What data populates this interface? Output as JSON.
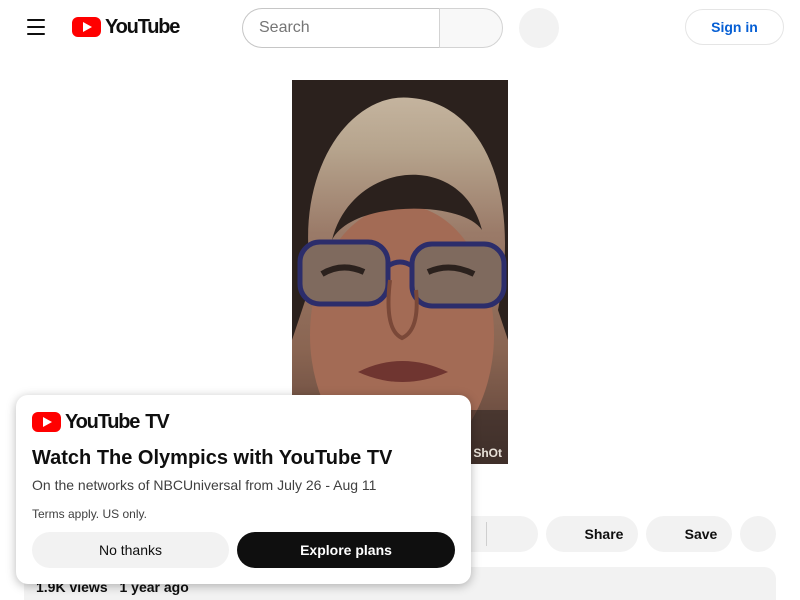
{
  "header": {
    "logo_text": "YouTube",
    "search_placeholder": "Search",
    "signin_label": "Sign in"
  },
  "video": {
    "watermark": "ShOt"
  },
  "actions": {
    "share_label": "Share",
    "save_label": "Save"
  },
  "description": {
    "views": "1.9K views",
    "age": "1 year ago"
  },
  "promo": {
    "logo_text": "YouTube",
    "logo_suffix": "TV",
    "title": "Watch The Olympics with YouTube TV",
    "subtitle": "On the networks of NBCUniversal from July 26 - Aug 11",
    "terms": "Terms apply. US only.",
    "no_thanks_label": "No thanks",
    "explore_label": "Explore plans"
  },
  "colors": {
    "brand_red": "#ff0000",
    "link_blue": "#065fd4"
  },
  "icons": [
    "menu-icon",
    "youtube-logo-icon",
    "search-icon",
    "mic-icon",
    "like-icon",
    "dislike-icon",
    "share-icon",
    "save-icon",
    "more-icon"
  ]
}
